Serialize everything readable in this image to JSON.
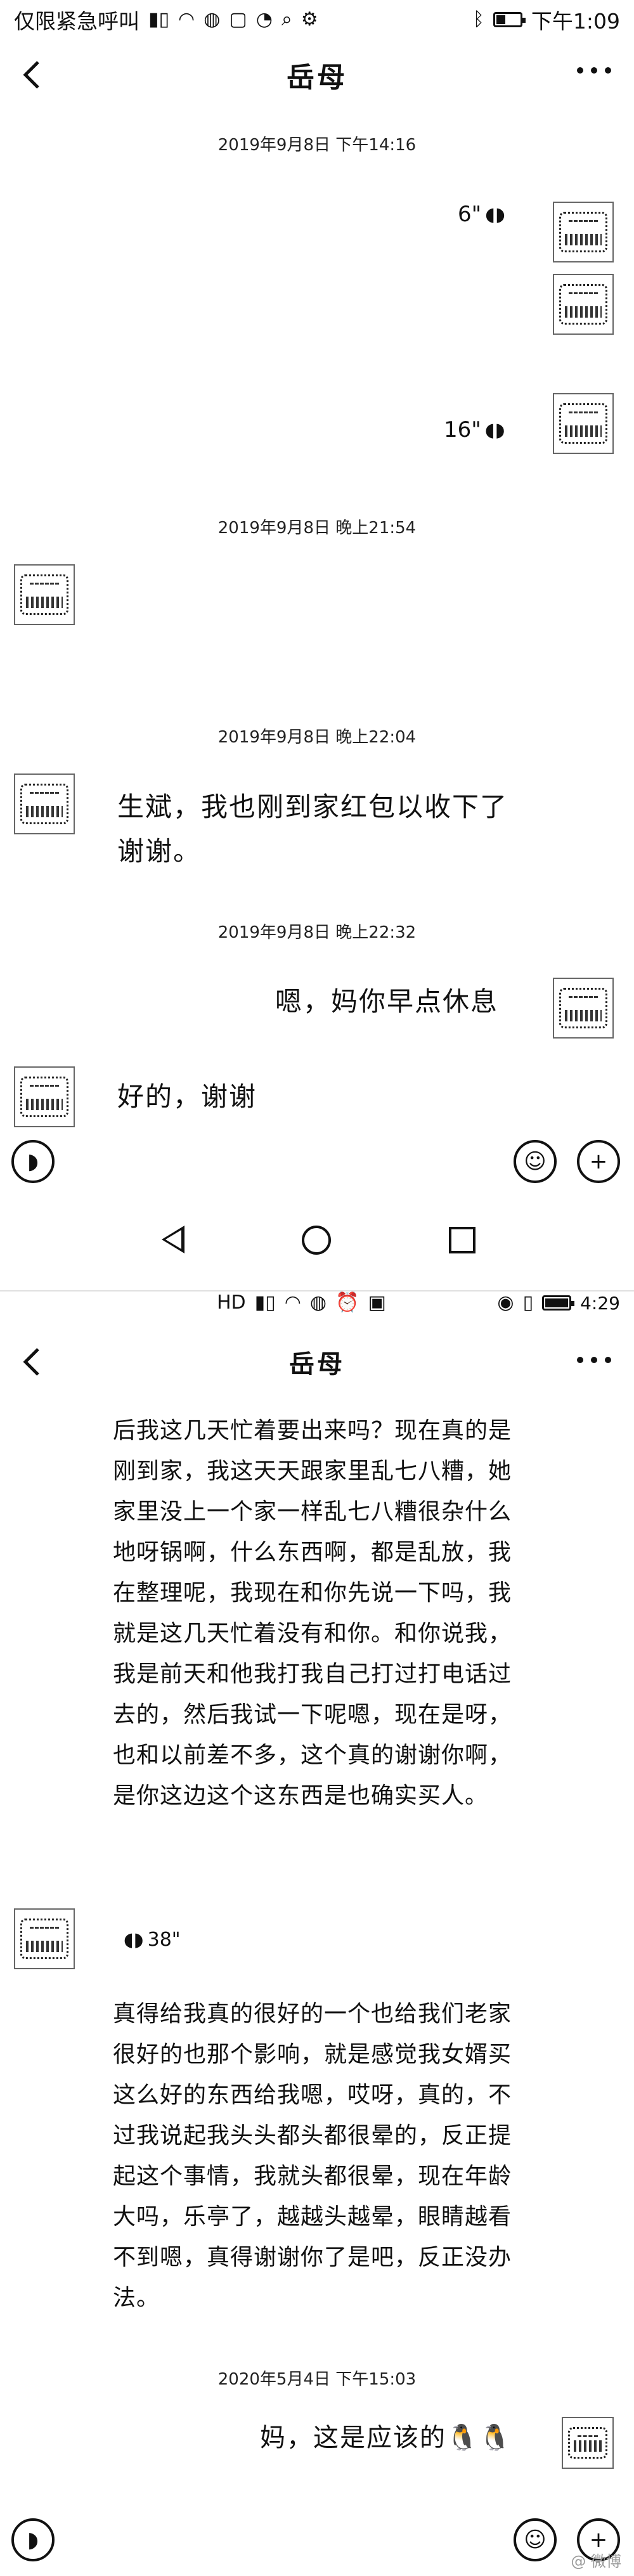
{
  "screen1": {
    "status": {
      "left_text": "仅限紧急呼叫",
      "right_time": "下午1:09",
      "battery_level": 0.35,
      "icons": [
        "signal-icon",
        "wifi-icon",
        "wechat-icon",
        "square-icon",
        "message-icon",
        "search-icon",
        "settings-icon",
        "bluetooth-icon",
        "battery-icon"
      ]
    },
    "nav": {
      "title": "岳母"
    },
    "timestamps": [
      "2019年9月8日 下午14:16",
      "2019年9月8日 晚上21:54",
      "2019年9月8日 晚上22:04",
      "2019年9月8日 晚上22:32"
    ],
    "voice_out_1": "6\"",
    "voice_out_2": "16\"",
    "msg_in_1": "生斌，我也刚到家红包以收下了谢谢。",
    "msg_out_1": "嗯，妈你早点休息",
    "msg_in_2": "好的，谢谢"
  },
  "screen2": {
    "status": {
      "right_time": "4:29",
      "icons": [
        "hd-icon",
        "signal-icon",
        "wifi-icon",
        "wechat-icon",
        "alarm-icon",
        "nfc-icon",
        "eye-icon",
        "vibrate-icon",
        "battery-icon"
      ]
    },
    "nav": {
      "title": "岳母"
    },
    "text_block_1": "后我这几天忙着要出来吗？现在真的是刚到家，我这天天跟家里乱七八糟，她家里没上一个家一样乱七八糟很杂什么地呀锅啊，什么东西啊，都是乱放，我在整理呢，我现在和你先说一下吗，我就是这几天忙着没有和你。和你说我，我是前天和他我打我自己打过打电话过去的，然后我试一下呢嗯，现在是呀，也和以前差不多，这个真的谢谢你啊，是你这边这个这东西是也确实买人。",
    "voice_in": "38\"",
    "text_block_2": "真得给我真的很好的一个也给我们老家很好的也那个影响，就是感觉我女婿买这么好的东西给我嗯，哎呀，真的，不过我说起我头头都头都很晕的，反正提起这个事情，我就头都很晕，现在年龄大吗，乐亭了，越越头越晕，眼睛越看不到嗯，真得谢谢你了是吧，反正没办法。",
    "timestamp": "2020年5月4日 下午15:03",
    "msg_out": "妈，这是应该的",
    "emoji": "🐧🐧",
    "watermark": "@ 微博"
  }
}
